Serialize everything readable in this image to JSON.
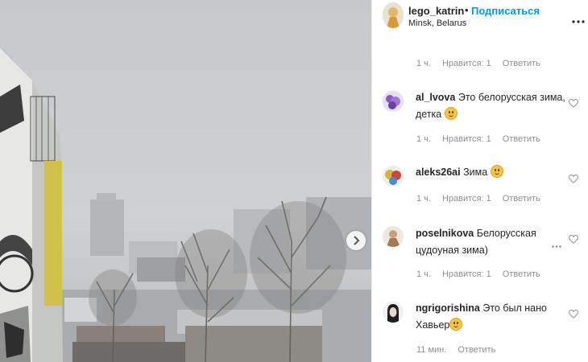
{
  "post": {
    "photo_alt_icon": "snowy-city-photo",
    "next_icon": "chevron-right-icon"
  },
  "header": {
    "username": "lego_katrin",
    "dot": "•",
    "follow_label": "Подписаться",
    "location": "Minsk, Belarus",
    "more_icon": "more-icon"
  },
  "first_meta": {
    "time": "1 ч.",
    "likes": "Нравится: 1",
    "reply": "Ответить"
  },
  "comments": [
    {
      "user": "al_lvova",
      "line1": "Это белорусская зима,",
      "line2": "детка",
      "time": "1 ч.",
      "likes": "Нравится: 1",
      "reply": "Ответить"
    },
    {
      "user": "aleks26ai",
      "line1": "Зима",
      "line2": "",
      "time": "1 ч.",
      "likes": "Нравится: 1",
      "reply": "Ответить"
    },
    {
      "user": "poselnikova",
      "line1": "Белорусская",
      "line2": "цудоуная зима)",
      "time": "1 ч.",
      "likes": "Нравится: 1",
      "reply": "Ответить"
    },
    {
      "user": "ngrigorishina",
      "line1": "Это был нано",
      "line2": "Хавьер",
      "time": "11 мин.",
      "likes": "",
      "reply": "Ответить"
    }
  ],
  "colors": {
    "link_blue": "#0095f6",
    "text": "#262626",
    "meta": "#8e8e8e"
  }
}
